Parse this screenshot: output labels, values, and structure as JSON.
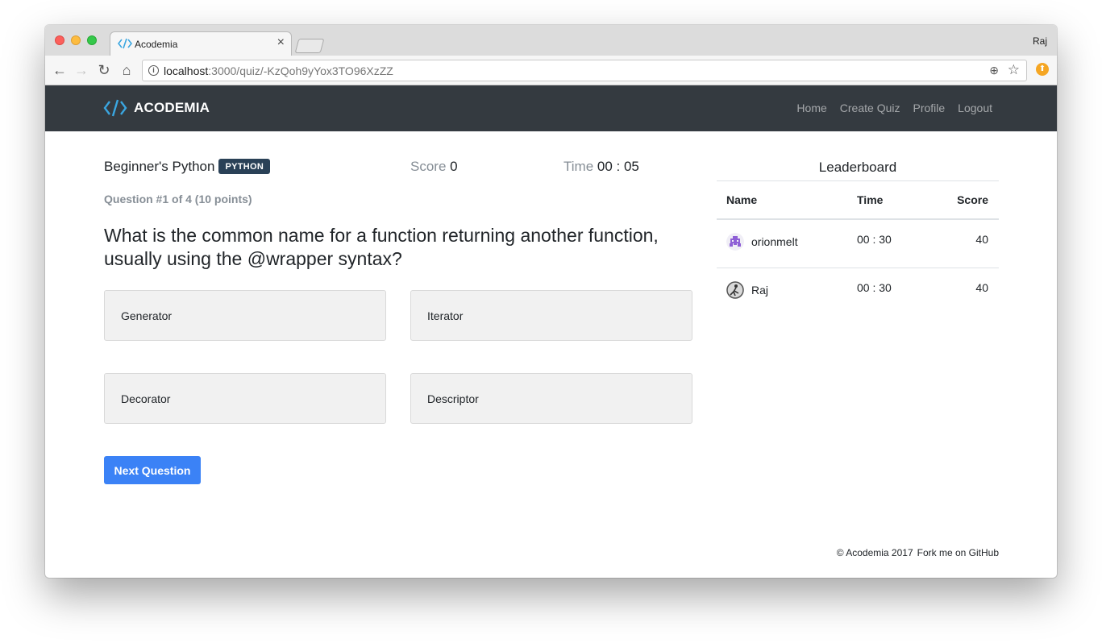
{
  "browser": {
    "tab_title": "Acodemia",
    "tab_close": "×",
    "profile_name": "Raj",
    "url_host": "localhost",
    "url_path": ":3000/quiz/-KzQoh9yYox3TO96XzZZ",
    "info_glyph": "i",
    "back_glyph": "←",
    "forward_glyph": "→",
    "reload_glyph": "↻",
    "home_glyph": "⌂",
    "zoom_glyph": "⊕",
    "star_glyph": "☆"
  },
  "navbar": {
    "brand": "ACODEMIA",
    "brand_color": "#3aa6e0",
    "links": [
      "Home",
      "Create Quiz",
      "Profile",
      "Logout"
    ]
  },
  "quiz": {
    "title": "Beginner's Python",
    "badge": "PYTHON",
    "score_label": "Score",
    "score_value": "0",
    "time_label": "Time",
    "time_value": "00 : 05",
    "question_meta": "Question #1 of 4 (10 points)",
    "question_text": "What is the common name for a function returning another function, usually using the @wrapper syntax?",
    "answers": [
      "Generator",
      "Iterator",
      "Decorator",
      "Descriptor"
    ],
    "next_button": "Next Question"
  },
  "leaderboard": {
    "title": "Leaderboard",
    "headers": {
      "name": "Name",
      "time": "Time",
      "score": "Score"
    },
    "rows": [
      {
        "name": "orionmelt",
        "time": "00 : 30",
        "score": "40",
        "avatar": "pixel-invader-avatar"
      },
      {
        "name": "Raj",
        "time": "00 : 30",
        "score": "40",
        "avatar": "photo-avatar"
      }
    ]
  },
  "footer": {
    "copyright": "© Acodemia 2017",
    "github_link": "Fork me on GitHub"
  }
}
